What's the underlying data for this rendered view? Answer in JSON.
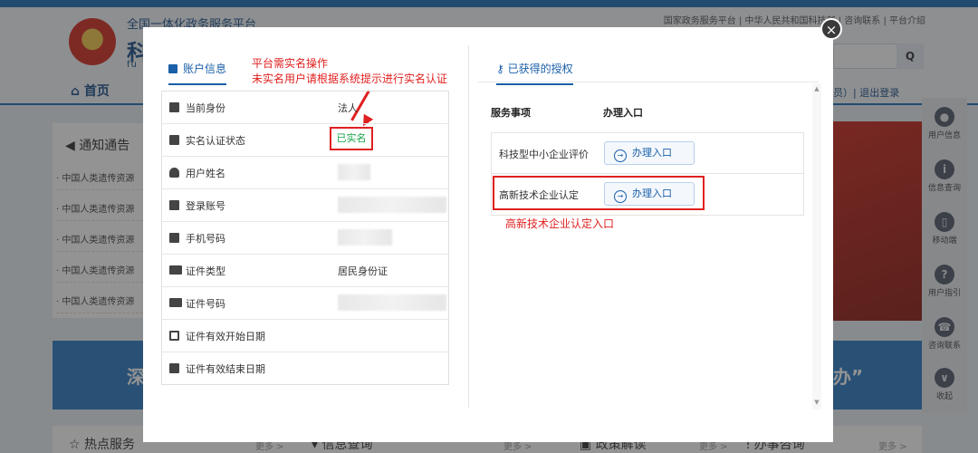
{
  "background": {
    "site_title": "全国一体化政务服务平台",
    "site_big": "科",
    "site_sub": "fu",
    "top_links": [
      "国家政务服务平台",
      "中华人民共和国科技部",
      "咨询联系",
      "平台介绍"
    ],
    "nav_home": "首页",
    "nav_right": "员）| 退出登录",
    "notice_title": "通知通告",
    "notice_items": [
      "中国人类遗传资源",
      "中国人类遗传资源",
      "中国人类遗传资源",
      "中国人类遗传资源",
      "中国人类遗传资源"
    ],
    "banner_left": "深",
    "banner_right": "办”",
    "bottom_items": [
      "热点服务",
      "信息查询",
      "政策解读",
      "办事咨询"
    ],
    "more_label": "更多 >",
    "sidebar": [
      "用户信息",
      "信息查询",
      "移动端",
      "用户指引",
      "咨询联系",
      "收起"
    ]
  },
  "modal": {
    "close_icon": "×",
    "account_tab": "账户信息",
    "annotation_line1": "平台需实名操作",
    "annotation_line2": "未实名用户请根据系统提示进行实名认证",
    "rows": [
      {
        "label": "当前身份",
        "value": "法人"
      },
      {
        "label": "实名认证状态",
        "value": "已实名"
      },
      {
        "label": "用户姓名",
        "value": ""
      },
      {
        "label": "登录账号",
        "value": ""
      },
      {
        "label": "手机号码",
        "value": ""
      },
      {
        "label": "证件类型",
        "value": "居民身份证"
      },
      {
        "label": "证件号码",
        "value": ""
      },
      {
        "label": "证件有效开始日期",
        "value": ""
      },
      {
        "label": "证件有效结束日期",
        "value": ""
      }
    ],
    "auth_tab": "已获得的授权",
    "auth_head_service": "服务事项",
    "auth_head_entry": "办理入口",
    "services": [
      {
        "name": "科技型中小企业评价",
        "button": "办理入口"
      },
      {
        "name": "高新技术企业认定",
        "button": "办理入口"
      }
    ],
    "service_annotation": "高新技术企业认定入口",
    "accent": "#1a5fa8",
    "alert": "#e02020"
  }
}
